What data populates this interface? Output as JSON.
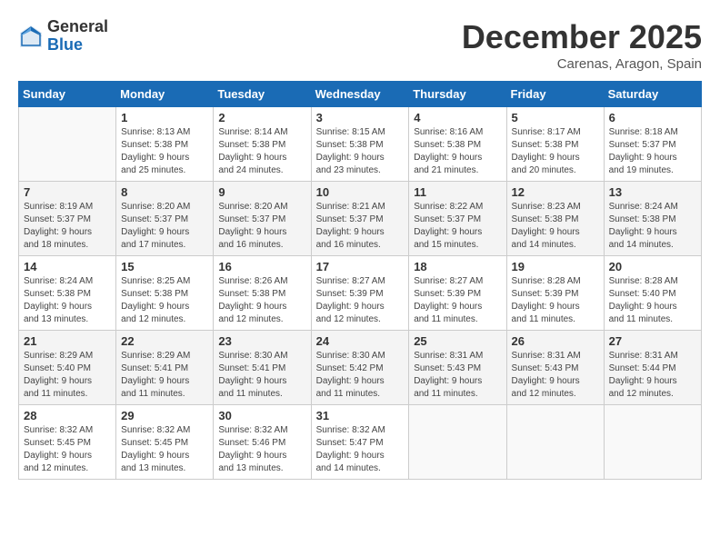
{
  "logo": {
    "general": "General",
    "blue": "Blue"
  },
  "title": "December 2025",
  "location": "Carenas, Aragon, Spain",
  "days_of_week": [
    "Sunday",
    "Monday",
    "Tuesday",
    "Wednesday",
    "Thursday",
    "Friday",
    "Saturday"
  ],
  "weeks": [
    [
      {
        "day": "",
        "info": ""
      },
      {
        "day": "1",
        "info": "Sunrise: 8:13 AM\nSunset: 5:38 PM\nDaylight: 9 hours\nand 25 minutes."
      },
      {
        "day": "2",
        "info": "Sunrise: 8:14 AM\nSunset: 5:38 PM\nDaylight: 9 hours\nand 24 minutes."
      },
      {
        "day": "3",
        "info": "Sunrise: 8:15 AM\nSunset: 5:38 PM\nDaylight: 9 hours\nand 23 minutes."
      },
      {
        "day": "4",
        "info": "Sunrise: 8:16 AM\nSunset: 5:38 PM\nDaylight: 9 hours\nand 21 minutes."
      },
      {
        "day": "5",
        "info": "Sunrise: 8:17 AM\nSunset: 5:38 PM\nDaylight: 9 hours\nand 20 minutes."
      },
      {
        "day": "6",
        "info": "Sunrise: 8:18 AM\nSunset: 5:37 PM\nDaylight: 9 hours\nand 19 minutes."
      }
    ],
    [
      {
        "day": "7",
        "info": "Sunrise: 8:19 AM\nSunset: 5:37 PM\nDaylight: 9 hours\nand 18 minutes."
      },
      {
        "day": "8",
        "info": "Sunrise: 8:20 AM\nSunset: 5:37 PM\nDaylight: 9 hours\nand 17 minutes."
      },
      {
        "day": "9",
        "info": "Sunrise: 8:20 AM\nSunset: 5:37 PM\nDaylight: 9 hours\nand 16 minutes."
      },
      {
        "day": "10",
        "info": "Sunrise: 8:21 AM\nSunset: 5:37 PM\nDaylight: 9 hours\nand 16 minutes."
      },
      {
        "day": "11",
        "info": "Sunrise: 8:22 AM\nSunset: 5:37 PM\nDaylight: 9 hours\nand 15 minutes."
      },
      {
        "day": "12",
        "info": "Sunrise: 8:23 AM\nSunset: 5:38 PM\nDaylight: 9 hours\nand 14 minutes."
      },
      {
        "day": "13",
        "info": "Sunrise: 8:24 AM\nSunset: 5:38 PM\nDaylight: 9 hours\nand 14 minutes."
      }
    ],
    [
      {
        "day": "14",
        "info": "Sunrise: 8:24 AM\nSunset: 5:38 PM\nDaylight: 9 hours\nand 13 minutes."
      },
      {
        "day": "15",
        "info": "Sunrise: 8:25 AM\nSunset: 5:38 PM\nDaylight: 9 hours\nand 12 minutes."
      },
      {
        "day": "16",
        "info": "Sunrise: 8:26 AM\nSunset: 5:38 PM\nDaylight: 9 hours\nand 12 minutes."
      },
      {
        "day": "17",
        "info": "Sunrise: 8:27 AM\nSunset: 5:39 PM\nDaylight: 9 hours\nand 12 minutes."
      },
      {
        "day": "18",
        "info": "Sunrise: 8:27 AM\nSunset: 5:39 PM\nDaylight: 9 hours\nand 11 minutes."
      },
      {
        "day": "19",
        "info": "Sunrise: 8:28 AM\nSunset: 5:39 PM\nDaylight: 9 hours\nand 11 minutes."
      },
      {
        "day": "20",
        "info": "Sunrise: 8:28 AM\nSunset: 5:40 PM\nDaylight: 9 hours\nand 11 minutes."
      }
    ],
    [
      {
        "day": "21",
        "info": "Sunrise: 8:29 AM\nSunset: 5:40 PM\nDaylight: 9 hours\nand 11 minutes."
      },
      {
        "day": "22",
        "info": "Sunrise: 8:29 AM\nSunset: 5:41 PM\nDaylight: 9 hours\nand 11 minutes."
      },
      {
        "day": "23",
        "info": "Sunrise: 8:30 AM\nSunset: 5:41 PM\nDaylight: 9 hours\nand 11 minutes."
      },
      {
        "day": "24",
        "info": "Sunrise: 8:30 AM\nSunset: 5:42 PM\nDaylight: 9 hours\nand 11 minutes."
      },
      {
        "day": "25",
        "info": "Sunrise: 8:31 AM\nSunset: 5:43 PM\nDaylight: 9 hours\nand 11 minutes."
      },
      {
        "day": "26",
        "info": "Sunrise: 8:31 AM\nSunset: 5:43 PM\nDaylight: 9 hours\nand 12 minutes."
      },
      {
        "day": "27",
        "info": "Sunrise: 8:31 AM\nSunset: 5:44 PM\nDaylight: 9 hours\nand 12 minutes."
      }
    ],
    [
      {
        "day": "28",
        "info": "Sunrise: 8:32 AM\nSunset: 5:45 PM\nDaylight: 9 hours\nand 12 minutes."
      },
      {
        "day": "29",
        "info": "Sunrise: 8:32 AM\nSunset: 5:45 PM\nDaylight: 9 hours\nand 13 minutes."
      },
      {
        "day": "30",
        "info": "Sunrise: 8:32 AM\nSunset: 5:46 PM\nDaylight: 9 hours\nand 13 minutes."
      },
      {
        "day": "31",
        "info": "Sunrise: 8:32 AM\nSunset: 5:47 PM\nDaylight: 9 hours\nand 14 minutes."
      },
      {
        "day": "",
        "info": ""
      },
      {
        "day": "",
        "info": ""
      },
      {
        "day": "",
        "info": ""
      }
    ]
  ]
}
